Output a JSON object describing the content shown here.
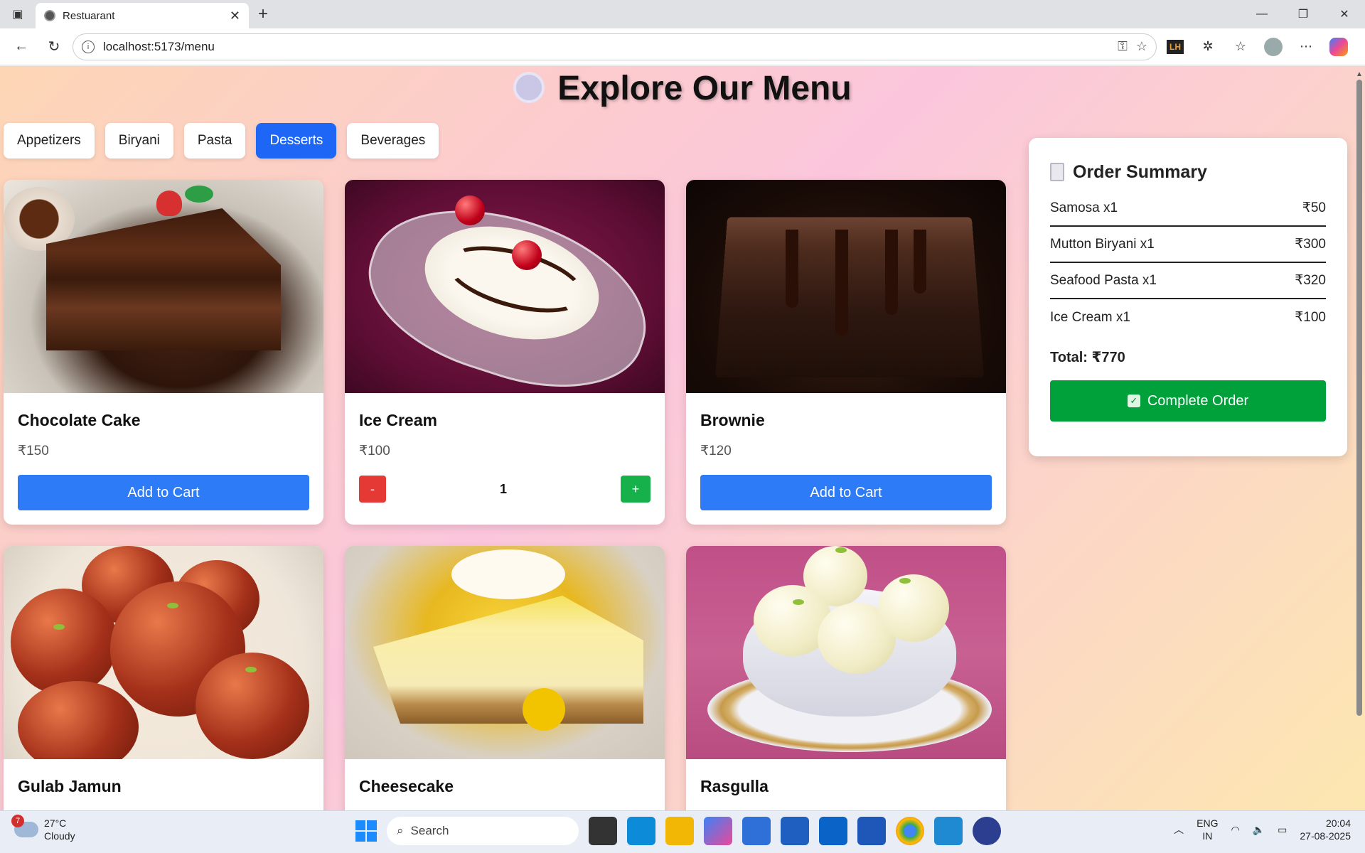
{
  "browser": {
    "tab_title": "Restuarant",
    "url": "localhost:5173/menu"
  },
  "page": {
    "title": "Explore Our Menu"
  },
  "categories": [
    {
      "label": "Appetizers",
      "active": false
    },
    {
      "label": "Biryani",
      "active": false
    },
    {
      "label": "Pasta",
      "active": false
    },
    {
      "label": "Desserts",
      "active": true
    },
    {
      "label": "Beverages",
      "active": false
    }
  ],
  "menu": [
    {
      "name": "Chocolate Cake",
      "price": "₹150",
      "action": "Add to Cart"
    },
    {
      "name": "Ice Cream",
      "price": "₹100",
      "quantity": "1",
      "minus": "-",
      "plus": "+"
    },
    {
      "name": "Brownie",
      "price": "₹120",
      "action": "Add to Cart"
    },
    {
      "name": "Gulab Jamun"
    },
    {
      "name": "Cheesecake"
    },
    {
      "name": "Rasgulla"
    }
  ],
  "summary": {
    "title": "Order Summary",
    "items": [
      {
        "label": "Samosa x1",
        "price": "₹50"
      },
      {
        "label": "Mutton Biryani x1",
        "price": "₹300"
      },
      {
        "label": "Seafood Pasta x1",
        "price": "₹320"
      },
      {
        "label": "Ice Cream x1",
        "price": "₹100"
      }
    ],
    "total": "Total: ₹770",
    "complete_label": "Complete Order"
  },
  "taskbar": {
    "weather_temp": "27°C",
    "weather_desc": "Cloudy",
    "weather_badge": "7",
    "search_placeholder": "Search",
    "lang_top": "ENG",
    "lang_bottom": "IN",
    "time": "20:04",
    "date": "27-08-2025"
  },
  "colors": {
    "accent_blue": "#1e66f5",
    "add_button": "#2d7bf7",
    "complete_green": "#00a13a",
    "minus_red": "#e53935",
    "plus_green": "#16b14a"
  }
}
